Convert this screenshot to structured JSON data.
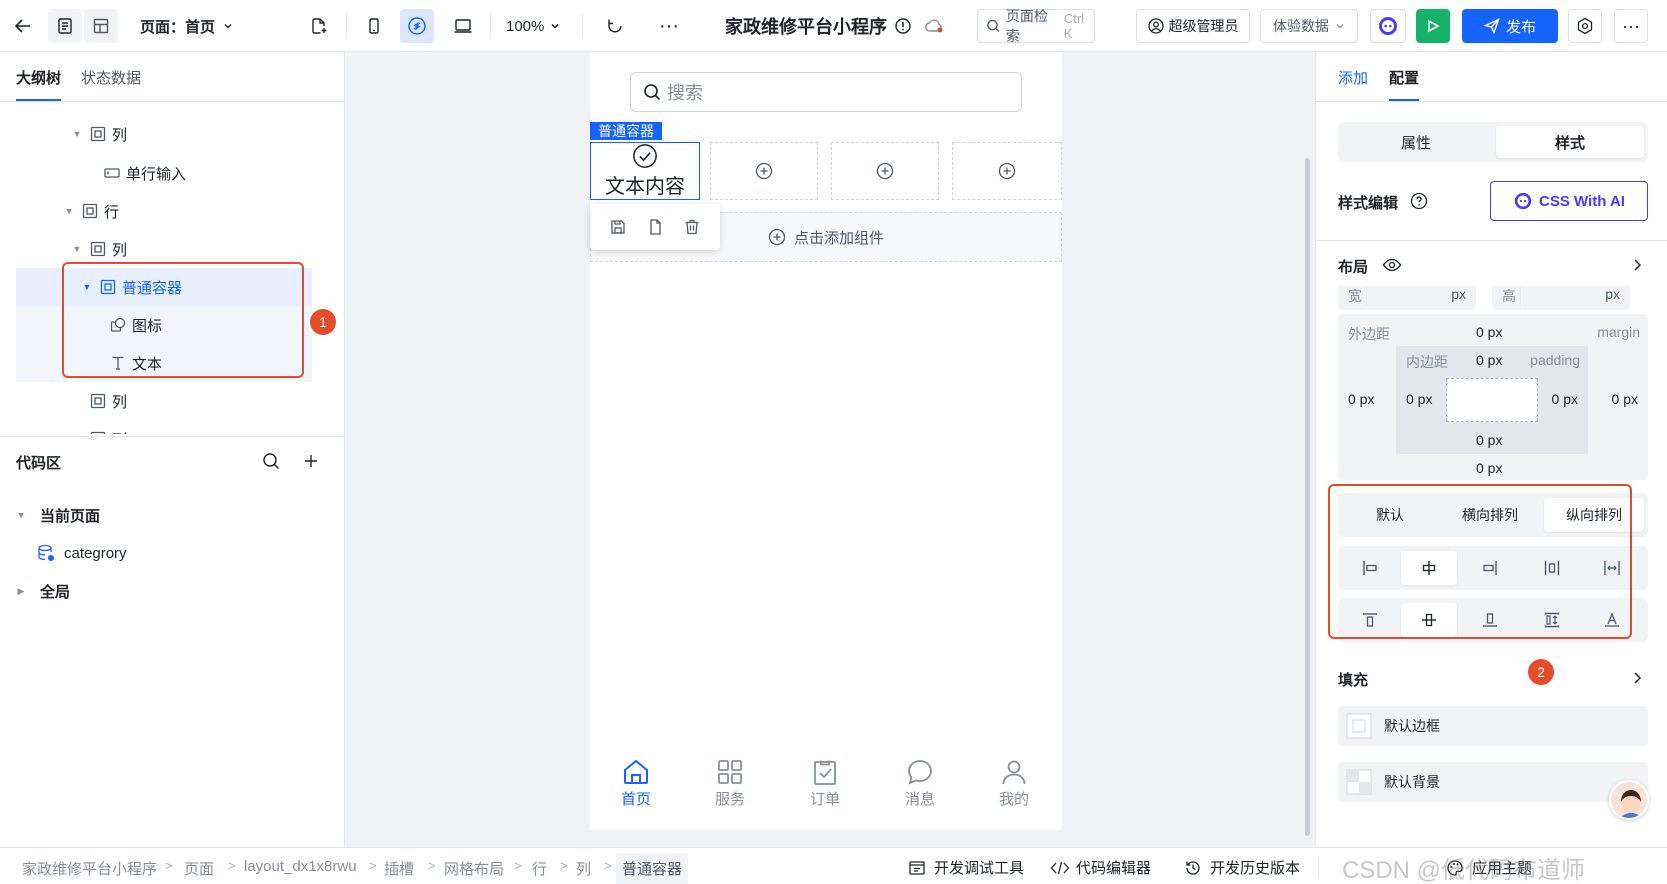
{
  "topbar": {
    "page_label": "页面：首页",
    "zoom": "100%",
    "app_title": "家政维修平台小程序",
    "search_placeholder": "页面检索",
    "search_shortcut": "Ctrl K",
    "user": "超级管理员",
    "data_mode": "体验数据",
    "publish": "发布"
  },
  "left": {
    "tabs": [
      "大纲树",
      "状态数据"
    ],
    "tree": [
      {
        "label": "列",
        "icon": "container-icon"
      },
      {
        "label": "单行输入",
        "icon": "input-icon"
      },
      {
        "label": "行",
        "icon": "container-icon"
      },
      {
        "label": "列",
        "icon": "container-icon"
      },
      {
        "label": "普通容器",
        "icon": "container-icon"
      },
      {
        "label": "图标",
        "icon": "shapes-icon"
      },
      {
        "label": "文本",
        "icon": "text-icon"
      },
      {
        "label": "列",
        "icon": "container-icon"
      },
      {
        "label": "列",
        "icon": "container-icon"
      }
    ],
    "code_area": {
      "title": "代码区",
      "current_page": "当前页面",
      "item": "categrory",
      "global": "全局"
    }
  },
  "canvas": {
    "search_placeholder": "搜索",
    "selected_tag": "普通容器",
    "text_content": "文本内容",
    "add_component": "点击添加组件",
    "tabbar": [
      "首页",
      "服务",
      "订单",
      "消息",
      "我的"
    ]
  },
  "right": {
    "tabs": [
      "添加",
      "配置"
    ],
    "mode_tabs": [
      "属性",
      "样式"
    ],
    "style_edit": "样式编辑",
    "css_ai": "CSS With AI",
    "layout": "布局",
    "width_label": "宽",
    "height_label": "高",
    "unit": "px",
    "margin_label": "外边距",
    "margin_en": "margin",
    "padding_label": "内边距",
    "padding_en": "padding",
    "zero_px": "0 px",
    "direction_tabs": [
      "默认",
      "横向排列",
      "纵向排列"
    ],
    "fill": "填充",
    "default_border": "默认边框",
    "default_bg": "默认背景"
  },
  "bottom": {
    "breadcrumb": [
      "家政维修平台小程序",
      "页面",
      "layout_dx1x8rwu",
      "插槽",
      "网格布局",
      "行",
      "列",
      "普通容器"
    ],
    "tools": [
      "开发调试工具",
      "代码编辑器",
      "开发历史版本"
    ],
    "apply_theme": "应用主题",
    "watermark": "CSDN @低代码布道师"
  },
  "annotations": [
    "1",
    "2"
  ]
}
